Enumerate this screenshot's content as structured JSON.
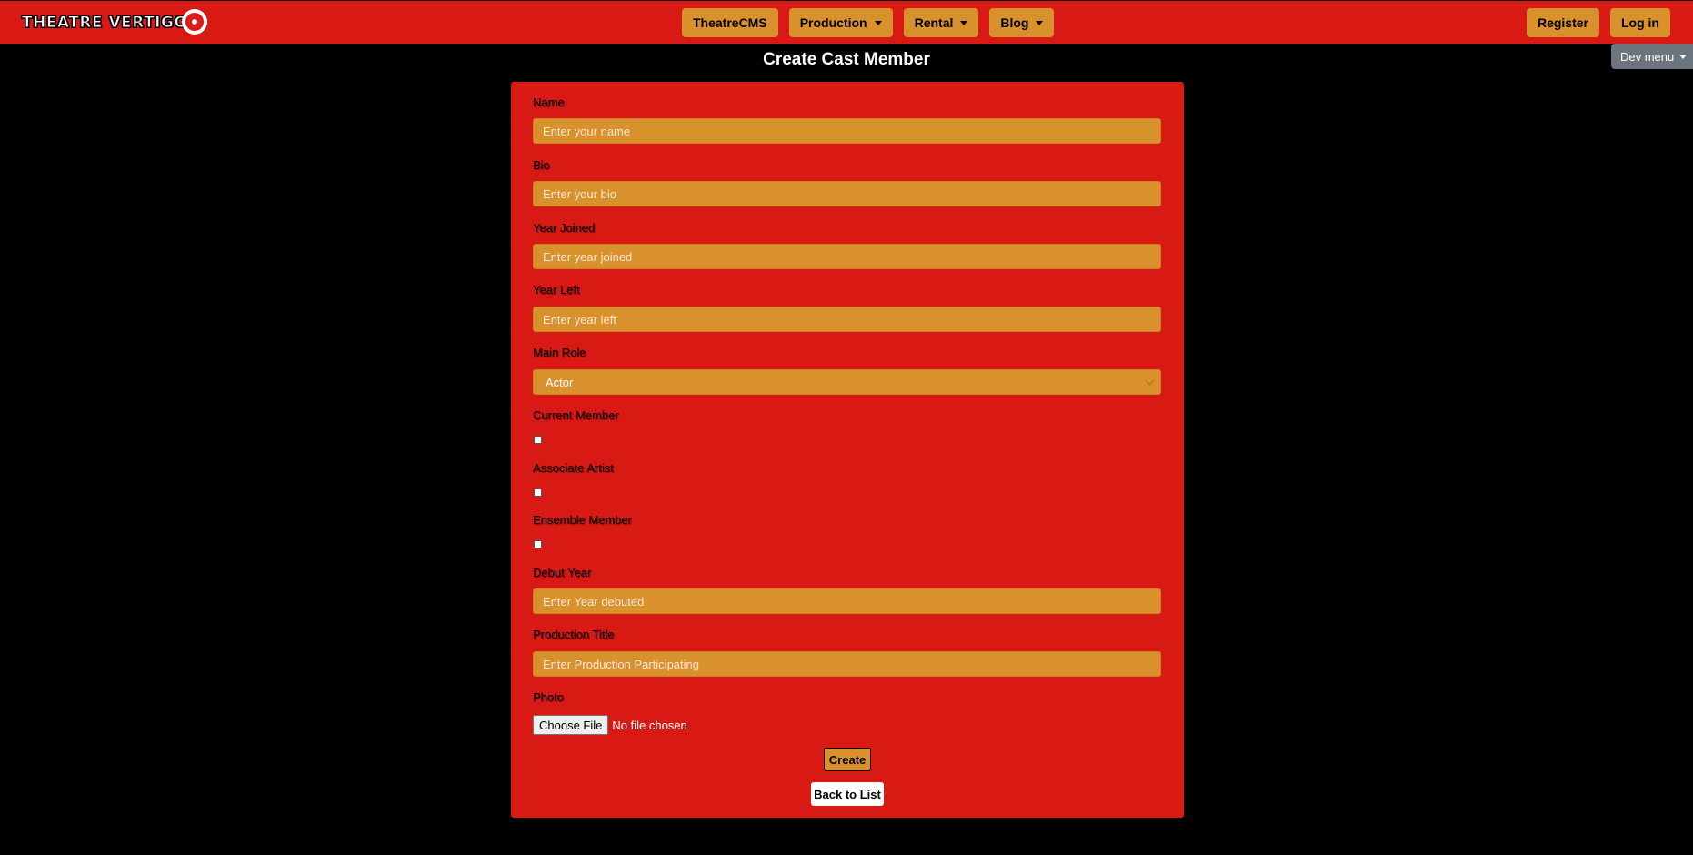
{
  "brand": {
    "logo_text": "THEATRE VERTIGO"
  },
  "nav": {
    "theatrecms": "TheatreCMS",
    "production": "Production",
    "rental": "Rental",
    "blog": "Blog",
    "register": "Register",
    "login": "Log in",
    "dev_menu": "Dev menu"
  },
  "page": {
    "title": "Create Cast Member"
  },
  "form": {
    "name": {
      "label": "Name",
      "placeholder": "Enter your name"
    },
    "bio": {
      "label": "Bio",
      "placeholder": "Enter your bio"
    },
    "year_joined": {
      "label": "Year Joined",
      "placeholder": "Enter year joined"
    },
    "year_left": {
      "label": "Year Left",
      "placeholder": "Enter year left"
    },
    "main_role": {
      "label": "Main Role",
      "value": "Actor"
    },
    "current_member": {
      "label": "Current Member",
      "checked": false
    },
    "associate_artist": {
      "label": "Associate Artist",
      "checked": false
    },
    "ensemble_member": {
      "label": "Ensemble Member",
      "checked": false
    },
    "debut_year": {
      "label": "Debut Year",
      "placeholder": "Enter Year debuted"
    },
    "production_title": {
      "label": "Production Title",
      "placeholder": "Enter Production Participating"
    },
    "photo": {
      "label": "Photo",
      "button": "Choose File",
      "status": "No file chosen"
    },
    "create_label": "Create",
    "back_label": "Back to List"
  },
  "colors": {
    "primary_red": "#d91a14",
    "accent_orange": "#d8912d",
    "background": "#000000",
    "dev_menu_gray": "#6c757d"
  }
}
